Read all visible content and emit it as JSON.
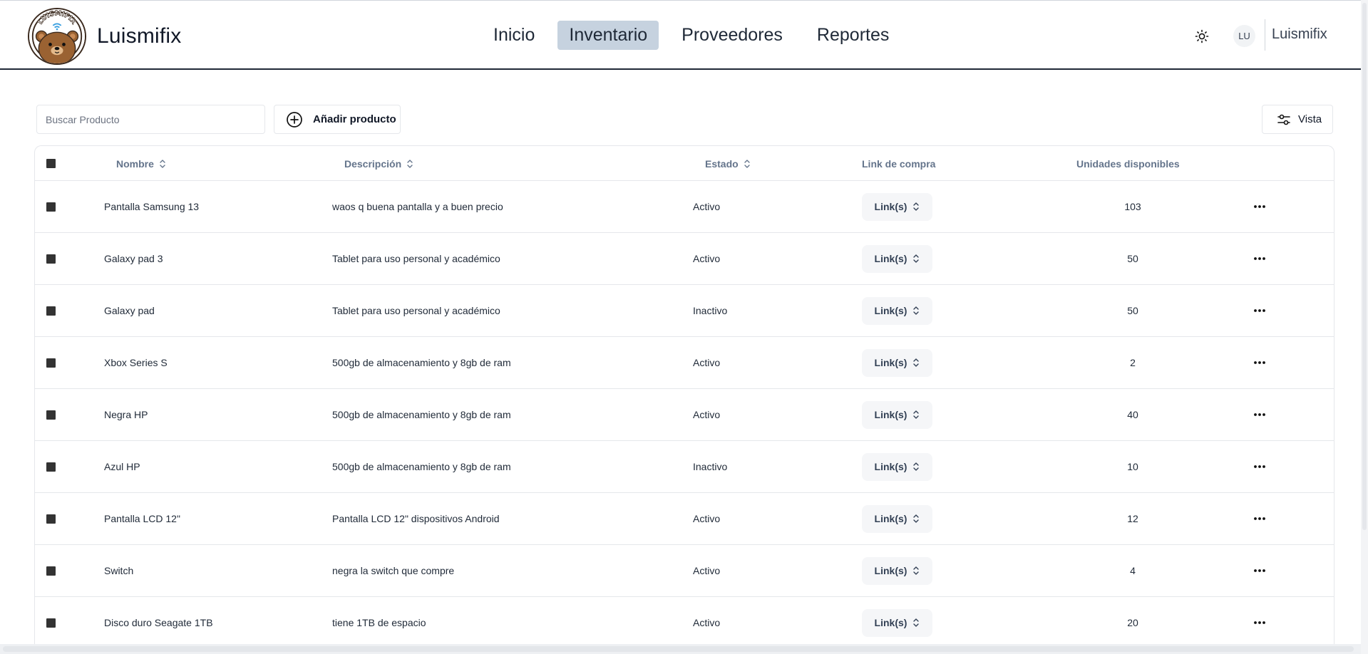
{
  "app": {
    "brand_name": "Luismifix",
    "logo_text": "LUISMIFIX"
  },
  "nav": {
    "items": [
      {
        "label": "Inicio",
        "active": false
      },
      {
        "label": "Inventario",
        "active": true
      },
      {
        "label": "Proveedores",
        "active": false
      },
      {
        "label": "Reportes",
        "active": false
      }
    ]
  },
  "user": {
    "initials": "LU",
    "name": "Luismifix",
    "theme_icon": "sun-icon"
  },
  "toolbar": {
    "search_placeholder": "Buscar Producto",
    "search_value": "",
    "add_label": "Añadir producto",
    "view_label": "Vista"
  },
  "table": {
    "columns": {
      "name": "Nombre",
      "description": "Descripción",
      "status": "Estado",
      "link": "Link de compra",
      "units": "Unidades disponibles"
    },
    "link_button_label": "Link(s)",
    "rows": [
      {
        "name": "Pantalla Samsung 13",
        "description": "waos q buena pantalla y a buen precio",
        "status": "Activo",
        "units": "103"
      },
      {
        "name": "Galaxy pad 3",
        "description": "Tablet para uso personal y académico",
        "status": "Activo",
        "units": "50"
      },
      {
        "name": "Galaxy pad",
        "description": "Tablet para uso personal y académico",
        "status": "Inactivo",
        "units": "50"
      },
      {
        "name": "Xbox Series S",
        "description": "500gb de almacenamiento y 8gb de ram",
        "status": "Activo",
        "units": "2"
      },
      {
        "name": "Negra HP",
        "description": "500gb de almacenamiento y 8gb de ram",
        "status": "Activo",
        "units": "40"
      },
      {
        "name": "Azul HP",
        "description": "500gb de almacenamiento y 8gb de ram",
        "status": "Inactivo",
        "units": "10"
      },
      {
        "name": "Pantalla LCD 12\"",
        "description": "Pantalla LCD 12\" dispositivos Android",
        "status": "Activo",
        "units": "12"
      },
      {
        "name": "Switch",
        "description": "negra la switch que compre",
        "status": "Activo",
        "units": "4"
      },
      {
        "name": "Disco duro Seagate 1TB",
        "description": "tiene 1TB de espacio",
        "status": "Activo",
        "units": "20"
      }
    ]
  },
  "colors": {
    "nav_active_bg": "#c6d2df",
    "header_border": "#1f2937",
    "muted_header_text": "#64748b",
    "checkbox": "#333333"
  }
}
